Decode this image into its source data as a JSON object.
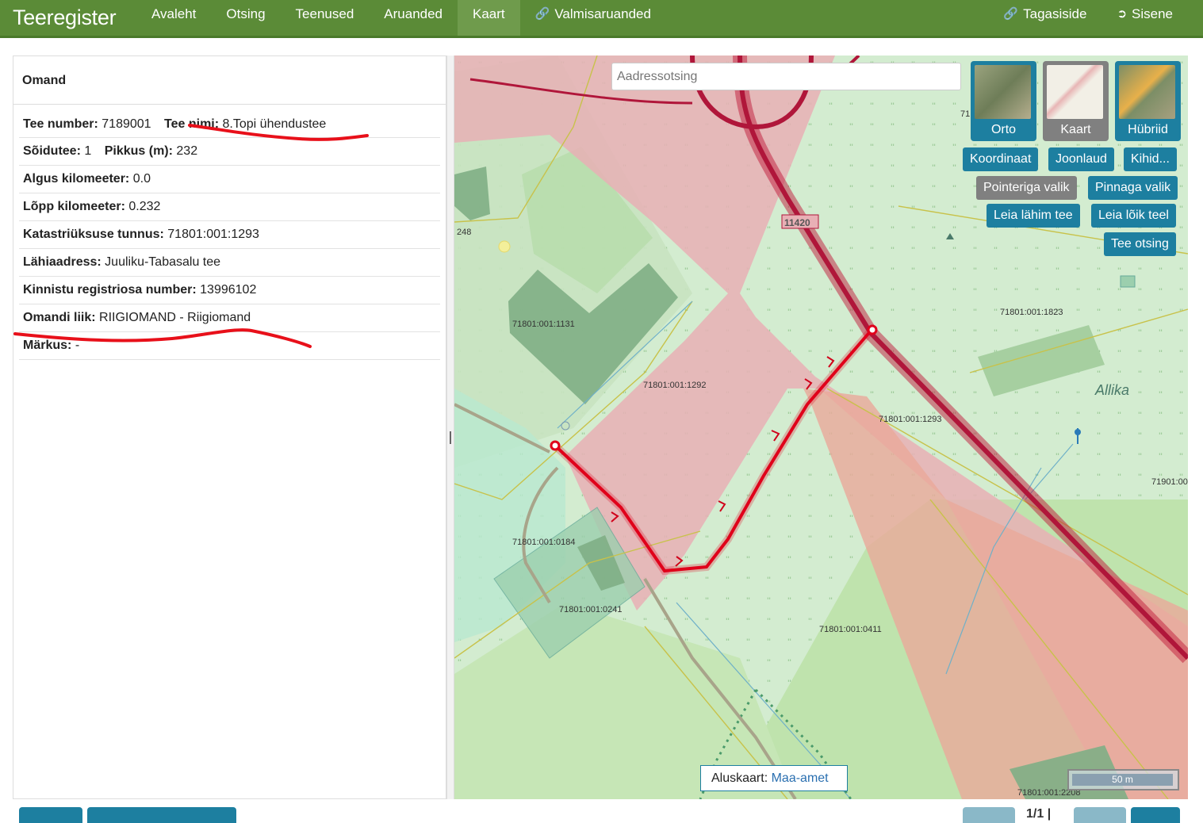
{
  "app": {
    "brand": "Teeregister"
  },
  "nav": {
    "items": [
      "Avaleht",
      "Otsing",
      "Teenused",
      "Aruanded",
      "Kaart"
    ],
    "active": "Kaart",
    "finished_reports": "Valmisaruanded",
    "feedback": "Tagasiside",
    "login": "Sisene"
  },
  "panel": {
    "title": "Omand",
    "rows": {
      "tee_number_label": "Tee number:",
      "tee_number_value": "7189001",
      "tee_nimi_label": "Tee nimi:",
      "tee_nimi_value": "8.Topi ühendustee",
      "soidutee_label": "Sõidutee:",
      "soidutee_value": "1",
      "pikkus_label": "Pikkus (m):",
      "pikkus_value": "232",
      "algus_label": "Algus kilomeeter:",
      "algus_value": "0.0",
      "lopp_label": "Lõpp kilomeeter:",
      "lopp_value": "0.232",
      "katastri_label": "Katastriüksuse tunnus:",
      "katastri_value": "71801:001:1293",
      "lahiaadress_label": "Lähiaadress:",
      "lahiaadress_value": "Juuliku-Tabasalu tee",
      "kinnistu_label": "Kinnistu registriosa number:",
      "kinnistu_value": "13996102",
      "omandi_label": "Omandi liik:",
      "omandi_value": "RIIGIOMAND - Riigiomand",
      "markus_label": "Märkus:",
      "markus_value": "-"
    }
  },
  "map": {
    "search_placeholder": "Aadressotsing",
    "layers": {
      "orto": "Orto",
      "kaart": "Kaart",
      "hubriid": "Hübriid"
    },
    "buttons": {
      "koordinaat": "Koordinaat",
      "joonlaud": "Joonlaud",
      "kihid": "Kihid...",
      "pointeriga": "Pointeriga valik",
      "pinnaga": "Pinnaga valik",
      "leia_lahim": "Leia lähim tee",
      "leia_loik": "Leia lõik teel",
      "tee_otsing": "Tee otsing"
    },
    "basemap_label": "Aluskaart:",
    "basemap_link": "Maa-amet",
    "scale": "50 m",
    "labels": {
      "p1131": "71801:001:1131",
      "p1292": "71801:001:1292",
      "p1293": "71801:001:1293",
      "p1823": "71801:001:1823",
      "p0184": "71801:001:0184",
      "p0241": "71801:001:0241",
      "p0411": "71801:001:0411",
      "p2208": "71801:001:2208",
      "p71901": "71901:00",
      "p248": "248",
      "road": "11420",
      "allika": "Allika",
      "n71": "71"
    },
    "colors": {
      "road_red": "#cc1133",
      "parcel_pink": "#e8b0b5",
      "accent": "#1d7fa0"
    }
  },
  "pager": {
    "text": "1/1 |"
  }
}
